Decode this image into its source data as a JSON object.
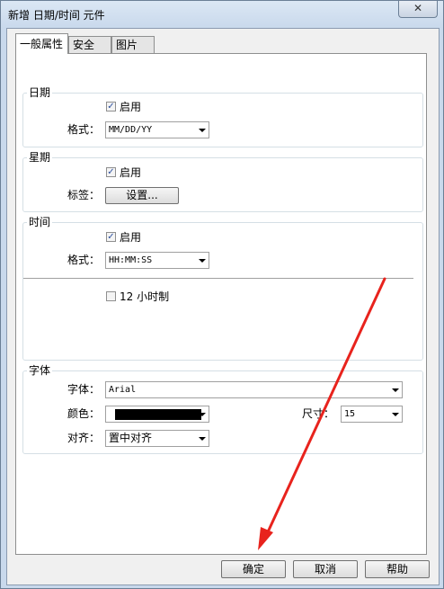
{
  "window": {
    "title": "新增 日期/时间 元件",
    "close_glyph": "✕"
  },
  "tabs": [
    {
      "label": "一般属性",
      "active": true
    },
    {
      "label": "安全",
      "active": false
    },
    {
      "label": "图片",
      "active": false
    }
  ],
  "date_group": {
    "title": "日期",
    "enable_label": "启用",
    "enabled": true,
    "format_label": "格式：",
    "format_value": "MM/DD/YY"
  },
  "week_group": {
    "title": "星期",
    "enable_label": "启用",
    "enabled": true,
    "tag_label": "标签：",
    "settings_button": "设置..."
  },
  "time_group": {
    "title": "时间",
    "enable_label": "启用",
    "enabled": true,
    "format_label": "格式：",
    "format_value": "HH:MM:SS",
    "hour12_label": "12 小时制",
    "hour12_checked": false
  },
  "font_group": {
    "title": "字体",
    "font_label": "字体：",
    "font_value": "Arial",
    "color_label": "颜色：",
    "color_value": "#000000",
    "size_label": "尺寸：",
    "size_value": "15",
    "align_label": "对齐：",
    "align_value": "置中对齐"
  },
  "buttons": {
    "ok": "确定",
    "cancel": "取消",
    "help": "帮助"
  },
  "colors": {
    "annotation_arrow": "#e8231d"
  }
}
